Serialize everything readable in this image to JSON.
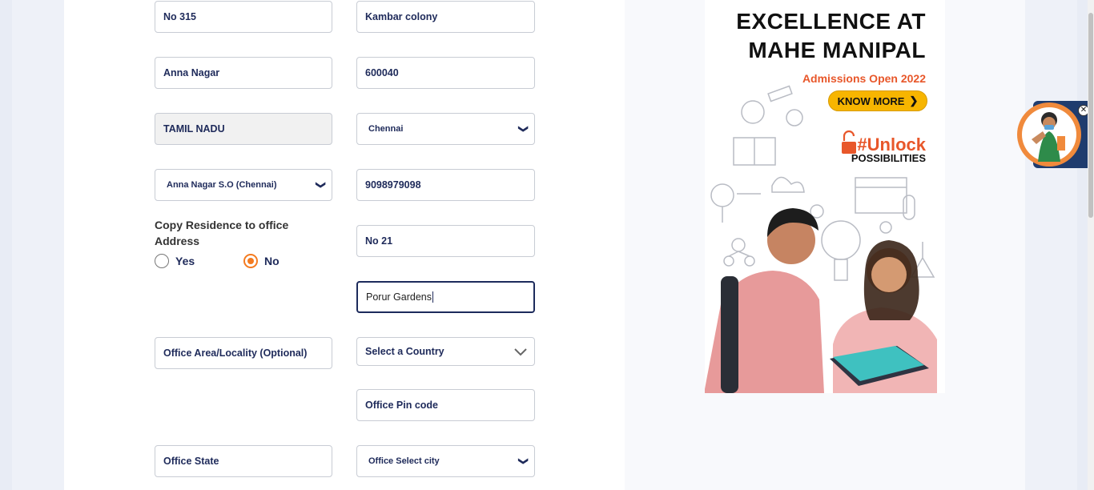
{
  "residence": {
    "house_no": "No 315",
    "street": "Kambar colony",
    "area": "Anna Nagar",
    "pin": "600040",
    "state": "TAMIL NADU",
    "city": "Chennai",
    "post_office": "Anna Nagar S.O (Chennai)",
    "phone": "9098979098"
  },
  "copy_section": {
    "label": "Copy Residence to office Address",
    "yes_label": "Yes",
    "no_label": "No",
    "selected": "No"
  },
  "office": {
    "house_no": "No 21",
    "street": "Porur Gardens",
    "area_placeholder": "Office Area/Locality (Optional)",
    "country_placeholder": "Select a Country",
    "pin_placeholder": "Office Pin code",
    "state_placeholder": "Office State",
    "city_placeholder": "Office Select city"
  },
  "ad": {
    "headline_line1": "EXCELLENCE AT",
    "headline_line2": "MAHE MANIPAL",
    "admissions": "Admissions Open 2022",
    "cta": "KNOW MORE",
    "unlock": "#Unlock",
    "possibilities": "POSSIBILITIES",
    "accent_color": "#e8572a",
    "button_color": "#f7b500"
  },
  "chat_widget": {
    "close_icon": "close-icon"
  }
}
